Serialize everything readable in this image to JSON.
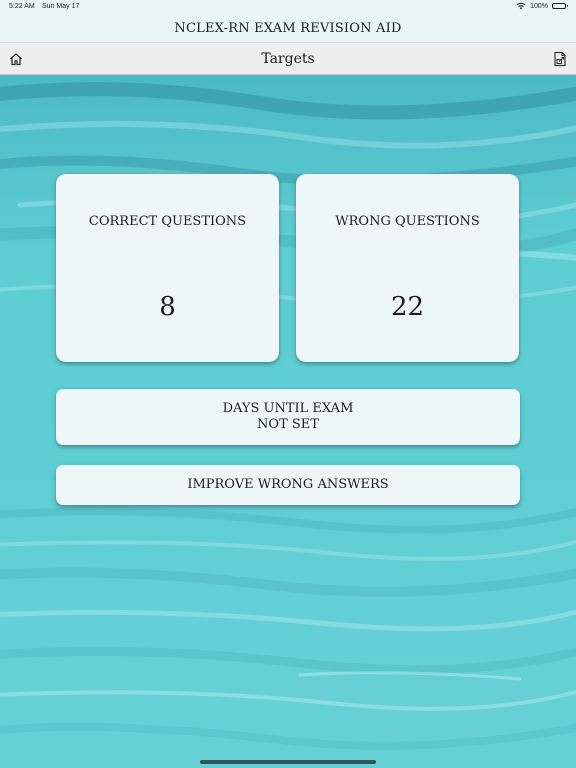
{
  "status_bar": {
    "time": "5:22 AM",
    "date": "Sun May 17",
    "battery": "100%"
  },
  "app": {
    "title": "NCLEX-RN EXAM REVISION AID"
  },
  "nav": {
    "title": "Targets",
    "left_icon": "home-icon",
    "right_icon": "export-icon"
  },
  "stats": {
    "correct_label": "CORRECT QUESTIONS",
    "correct_value": "8",
    "wrong_label": "WRONG QUESTIONS",
    "wrong_value": "22"
  },
  "days_until_exam": {
    "label": "DAYS UNTIL EXAM",
    "value": "NOT SET"
  },
  "improve": {
    "label": "IMPROVE WRONG ANSWERS"
  },
  "colors": {
    "background": "#5fcdd4",
    "card": "#eef7f8",
    "header": "#e9f6f7",
    "nav": "#eeeeee"
  }
}
